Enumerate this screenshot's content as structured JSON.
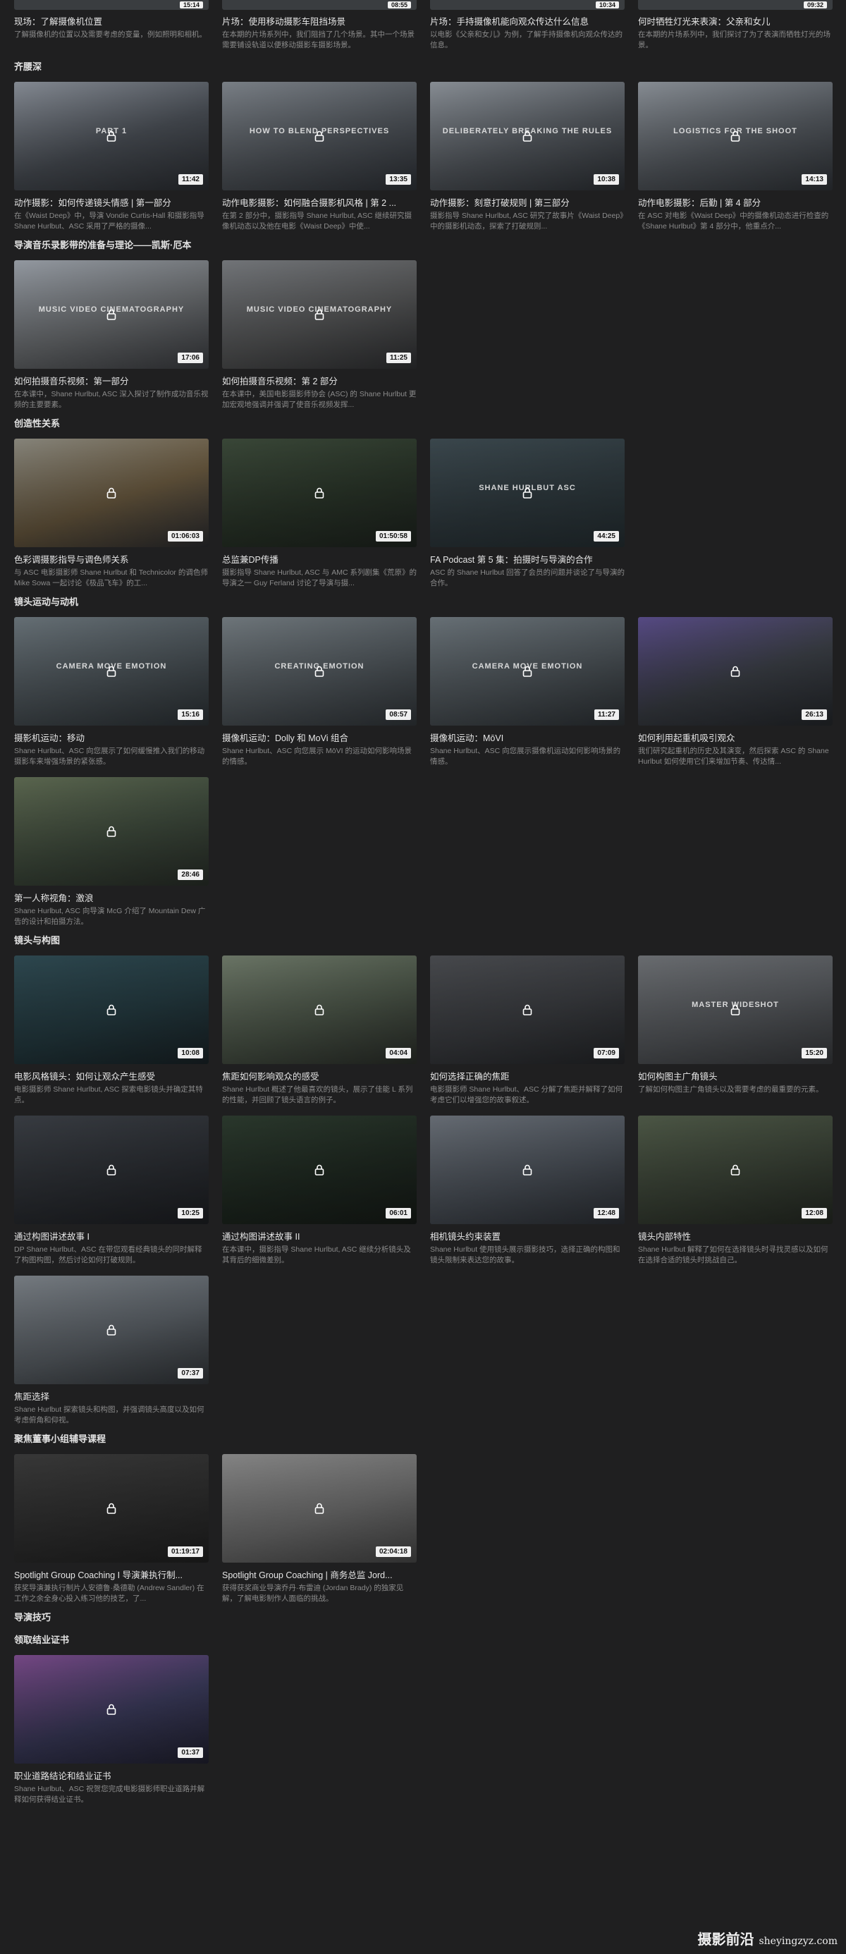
{
  "top_row": [
    {
      "title": "现场：了解摄像机位置",
      "desc": "了解摄像机的位置以及需要考虑的变量，例如照明和相机。",
      "duration": "15:14"
    },
    {
      "title": "片场：使用移动摄影车阻挡场景",
      "desc": "在本期的片场系列中，我们阻挡了几个场景。其中一个场景需要铺设轨道以便移动摄影车摄影场景。",
      "duration": "08:55"
    },
    {
      "title": "片场：手持摄像机能向观众传达什么信息",
      "desc": "以电影《父亲和女儿》为例，了解手持摄像机向观众传达的信息。",
      "duration": "10:34"
    },
    {
      "title": "何时牺牲灯光来表演：父亲和女儿",
      "desc": "在本期的片场系列中，我们探讨了为了表演而牺牲灯光的场景。",
      "duration": "09:32"
    }
  ],
  "sections": [
    {
      "title": "齐腰深",
      "cards": [
        {
          "title": "动作摄影：如何传递镜头情感 | 第一部分",
          "desc": "在《Waist Deep》中，导演 Vondie Curtis-Hall 和摄影指导 Shane Hurlbut、ASC 采用了严格的摄像...",
          "duration": "11:42",
          "overlay": "PART 1",
          "bg": [
            "#8a9099",
            "#4a4f56",
            "#2d3035"
          ]
        },
        {
          "title": "动作电影摄影：如何融合摄影机风格 | 第 2 ...",
          "desc": "在第 2 部分中，摄影指导 Shane Hurlbut, ASC 继续研究摄像机动态以及他在电影《Waist Deep》中使...",
          "duration": "13:35",
          "overlay": "HOW TO BLEND PERSPECTIVES",
          "bg": [
            "#7f858c",
            "#51565c",
            "#30343a"
          ]
        },
        {
          "title": "动作摄影：刻意打破规则 | 第三部分",
          "desc": "摄影指导 Shane Hurlbut, ASC 研究了故事片《Waist Deep》中的摄影机动态，探索了打破规则...",
          "duration": "10:38",
          "overlay": "DELIBERATELY BREAKING THE RULES",
          "bg": [
            "#8e949b",
            "#555a60",
            "#2f3338"
          ]
        },
        {
          "title": "动作电影摄影：后勤 | 第 4 部分",
          "desc": "在 ASC 对电影《Waist Deep》中的摄像机动态进行检查的《Shane Hurlbut》第 4 部分中，他重点介...",
          "duration": "14:13",
          "overlay": "LOGISTICS FOR THE SHOOT",
          "bg": [
            "#8d939a",
            "#565b61",
            "#32363b"
          ]
        }
      ]
    },
    {
      "title": "导演音乐录影带的准备与理论——凯斯·厄本",
      "cards": [
        {
          "title": "如何拍摄音乐视频：第一部分",
          "desc": "在本课中，Shane Hurlbut, ASC 深入探讨了制作成功音乐视频的主要要素。",
          "duration": "17:06",
          "overlay": "MUSIC VIDEO CINEMATOGRAPHY",
          "bg": [
            "#9aa0a8",
            "#6c6f72",
            "#3e4044"
          ]
        },
        {
          "title": "如何拍摄音乐视频：第 2 部分",
          "desc": "在本课中，美国电影摄影师协会 (ASC) 的 Shane Hurlbut 更加宏观地强调并强调了使音乐视频发挥...",
          "duration": "11:25",
          "overlay": "MUSIC VIDEO CINEMATOGRAPHY",
          "bg": [
            "#777a7e",
            "#565758",
            "#323335"
          ]
        }
      ]
    },
    {
      "title": "创造性关系",
      "cards": [
        {
          "title": "色彩调摄影指导与调色师关系",
          "desc": "与 ASC 电影摄影师 Shane Hurlbut 和 Technicolor 的调色师 Mike Sowa 一起讨论《极品飞车》的工...",
          "duration": "01:06:03",
          "overlay": "",
          "bg": [
            "#8c8a80",
            "#6a5a40",
            "#2c2d31"
          ]
        },
        {
          "title": "总监兼DP传播",
          "desc": "摄影指导 Shane Hurlbut, ASC 与 AMC 系列剧集《荒原》的导演之一 Guy Ferland 讨论了导演与摄...",
          "duration": "01:50:58",
          "overlay": "",
          "bg": [
            "#3c4a3a",
            "#2a3529",
            "#1f2520"
          ]
        },
        {
          "title": "FA Podcast 第 5 集：拍摄时与导演的合作",
          "desc": "ASC 的 Shane Hurlbut 回答了会员的问题并谈论了与导演的合作。",
          "duration": "44:25",
          "overlay": "SHANE HURLBUT ASC",
          "bg": [
            "#3d4a50",
            "#2f3a3f",
            "#263034"
          ]
        }
      ]
    },
    {
      "title": "镜头运动与动机",
      "cards": [
        {
          "title": "摄影机运动：移动",
          "desc": "Shane Hurlbut、ASC 向您展示了如何缓慢推入我们的移动摄影车来增强场景的紧张感。",
          "duration": "15:16",
          "overlay": "CAMERA MOVE EMOTION",
          "bg": [
            "#6a747a",
            "#4a5257",
            "#2e3438"
          ]
        },
        {
          "title": "摄像机运动：Dolly 和 MoVi 组合",
          "desc": "Shane Hurlbut、ASC 向您展示 MōVI 的运动如何影响场景的情感。",
          "duration": "08:57",
          "overlay": "CREATING EMOTION",
          "bg": [
            "#737b80",
            "#51585d",
            "#33383c"
          ]
        },
        {
          "title": "摄像机运动：MōVI",
          "desc": "Shane Hurlbut、ASC 向您展示摄像机运动如何影响场景的情感。",
          "duration": "11:27",
          "overlay": "CAMERA MOVE EMOTION",
          "bg": [
            "#6c757b",
            "#4d5459",
            "#2f3438"
          ]
        },
        {
          "title": "如何利用起重机吸引观众",
          "desc": "我们研究起重机的历史及其演变，然后探索 ASC 的 Shane Hurlbut 如何使用它们来增加节奏、传达情...",
          "duration": "26:13",
          "overlay": "",
          "bg": [
            "#5a4d8a",
            "#3b3f46",
            "#26292d"
          ]
        },
        {
          "title": "第一人称视角：激浪",
          "desc": "Shane Hurlbut, ASC 向导演 McG 介绍了 Mountain Dew 广告的设计和拍摄方法。",
          "duration": "28:46",
          "overlay": "",
          "bg": [
            "#5e6a52",
            "#3e4a3c",
            "#2a302a"
          ]
        }
      ]
    },
    {
      "title": "镜头与构图",
      "cards": [
        {
          "title": "电影风格镜头：如何让观众产生感受",
          "desc": "电影摄影师 Shane Hurlbut, ASC 探索电影镜头并确定其特点。",
          "duration": "10:08",
          "overlay": "",
          "bg": [
            "#2f4a52",
            "#243a40",
            "#1a2428"
          ]
        },
        {
          "title": "焦距如何影响观众的感受",
          "desc": "Shane Hurlbut 概述了他最喜欢的镜头，展示了佳能 L 系列的性能，并回顾了镜头语言的例子。",
          "duration": "04:04",
          "overlay": "",
          "bg": [
            "#6f7a6a",
            "#4b5548",
            "#2c302b"
          ]
        },
        {
          "title": "如何选择正确的焦距",
          "desc": "电影摄影师 Shane Hurlbut、ASC 分解了焦距并解释了如何考虑它们以增强您的故事叙述。",
          "duration": "07:09",
          "overlay": "",
          "bg": [
            "#4a4c50",
            "#3a3c40",
            "#26282b"
          ]
        },
        {
          "title": "如何构图主广角镜头",
          "desc": "了解如何构图主广角镜头以及需要考虑的最重要的元素。",
          "duration": "15:20",
          "overlay": "MASTER WIDESHOT",
          "bg": [
            "#6e7175",
            "#55585c",
            "#3a3c3f"
          ]
        },
        {
          "title": "通过构图讲述故事 I",
          "desc": "DP Shane Hurlbut、ASC 在带您观看经典镜头的同时解释了构图构图，然后讨论如何打破规则。",
          "duration": "10:25",
          "overlay": "",
          "bg": [
            "#3a3e44",
            "#2b2e33",
            "#1e2024"
          ]
        },
        {
          "title": "通过构图讲述故事 II",
          "desc": "在本课中，摄影指导 Shane Hurlbut, ASC 继续分析镜头及其背后的细微差别。",
          "duration": "06:01",
          "overlay": "",
          "bg": [
            "#2c3a2e",
            "#1f2921",
            "#171c18"
          ]
        },
        {
          "title": "相机镜头约束装置",
          "desc": "Shane Hurlbut 使用镜头展示摄影技巧，选择正确的构图和镜头限制来表达您的故事。",
          "duration": "12:48",
          "overlay": "",
          "bg": [
            "#6a7078",
            "#4a5058",
            "#2e3238"
          ]
        },
        {
          "title": "镜头内部特性",
          "desc": "Shane Hurlbut 解释了如何在选择镜头时寻找灵感以及如何在选择合适的镜头时挑战自己。",
          "duration": "12:08",
          "overlay": "",
          "bg": [
            "#4f5a48",
            "#3a4236",
            "#262b24"
          ]
        },
        {
          "title": "焦距选择",
          "desc": "Shane Hurlbut 探索镜头和构图，并强调镜头高度以及如何考虑俯角和仰视。",
          "duration": "07:37",
          "overlay": "",
          "bg": [
            "#7a8086",
            "#5a6066",
            "#34383c"
          ]
        }
      ]
    },
    {
      "title": "聚焦董事小组辅导课程",
      "cards": [
        {
          "title": "Spotlight Group Coaching I 导演兼执行制...",
          "desc": "获奖导演兼执行制片人安德鲁·桑德勒 (Andrew Sandler) 在工作之余全身心投入练习他的技艺，了...",
          "duration": "01:19:17",
          "overlay": "",
          "bg": [
            "#3a3a3a",
            "#2e2e2e",
            "#222222"
          ]
        },
        {
          "title": "Spotlight Group Coaching | 商务总监 Jord...",
          "desc": "获得获奖商业导演乔丹·布雷迪 (Jordan Brady) 的独家见解，了解电影制作人面临的挑战。",
          "duration": "02:04:18",
          "overlay": "",
          "bg": [
            "#8a8a8a",
            "#6e6e6e",
            "#4a4a4a"
          ]
        }
      ]
    },
    {
      "title": "导演技巧",
      "cards": []
    },
    {
      "title": "领取结业证书",
      "cards": [
        {
          "title": "职业道路结论和结业证书",
          "desc": "Shane Hurlbut、ASC 祝贺您完成电影摄影师职业道路并解释如何获得结业证书。",
          "duration": "01:37",
          "overlay": "",
          "bg": [
            "#7a4a8a",
            "#3a3a5a",
            "#222232"
          ]
        }
      ]
    }
  ],
  "watermark": {
    "cn": "摄影前沿",
    "en": "sheyingzyz.com"
  },
  "icons": {
    "lock": "lock-icon"
  }
}
